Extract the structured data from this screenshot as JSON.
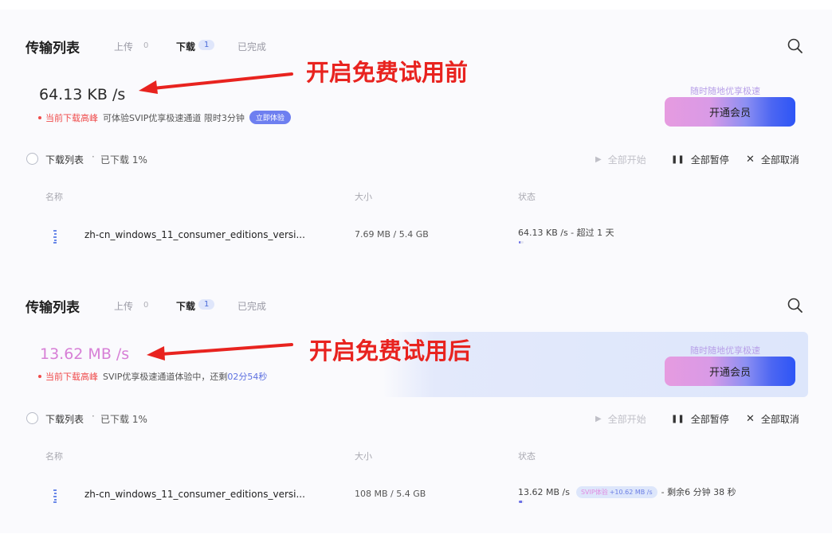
{
  "colors": {
    "accent": "#4b6bd8",
    "peak": "#ef4b4b",
    "annotation": "#e8231f",
    "pink_speed": "#d77fd6"
  },
  "before": {
    "title": "传输列表",
    "tabs": {
      "upload": "上传",
      "upload_count": "0",
      "download": "下载",
      "download_count": "1",
      "done": "已完成"
    },
    "speed": "64.13 KB /s",
    "hint": {
      "peak": "当前下载高峰",
      "text": "可体验SVIP优享极速通道 限时3分钟",
      "badge": "立即体验"
    },
    "vip": {
      "slogan": "随时随地优享极速",
      "button": "开通会员"
    },
    "list": {
      "label": "下载列表",
      "separator": "·",
      "progress": "已下载 1%"
    },
    "controls": {
      "start": "全部开始",
      "pause": "全部暂停",
      "cancel": "全部取消"
    },
    "columns": {
      "name": "名称",
      "size": "大小",
      "status": "状态"
    },
    "file": {
      "name": "zh-cn_windows_11_consumer_editions_versi...",
      "size": "7.69 MB / 5.4 GB",
      "status": "64.13 KB /s - 超过 1 天",
      "progress_percent": 1
    },
    "annotation": "开启免费试用前"
  },
  "after": {
    "title": "传输列表",
    "tabs": {
      "upload": "上传",
      "upload_count": "0",
      "download": "下载",
      "download_count": "1",
      "done": "已完成"
    },
    "speed": "13.62 MB /s",
    "hint": {
      "peak": "当前下载高峰",
      "text": "SVIP优享极速通道体验中，还剩",
      "countdown": "02分54秒"
    },
    "vip": {
      "slogan": "随时随地优享极速",
      "button": "开通会员"
    },
    "list": {
      "label": "下载列表",
      "separator": "·",
      "progress": "已下载 1%"
    },
    "controls": {
      "start": "全部开始",
      "pause": "全部暂停",
      "cancel": "全部取消"
    },
    "columns": {
      "name": "名称",
      "size": "大小",
      "status": "状态"
    },
    "file": {
      "name": "zh-cn_windows_11_consumer_editions_versi...",
      "size": "108 MB / 5.4 GB",
      "speed": "13.62 MB /s",
      "svip_label": "SVIP体验",
      "svip_boost": "+10.62 MB /s",
      "remaining": "- 剩余6 分钟 38 秒",
      "progress_percent": 2
    },
    "annotation": "开启免费试用后"
  },
  "icons": {
    "search": "search-icon",
    "play": "play-icon",
    "pause": "pause-icon",
    "cancel": "close-icon",
    "file": "file-icon"
  }
}
